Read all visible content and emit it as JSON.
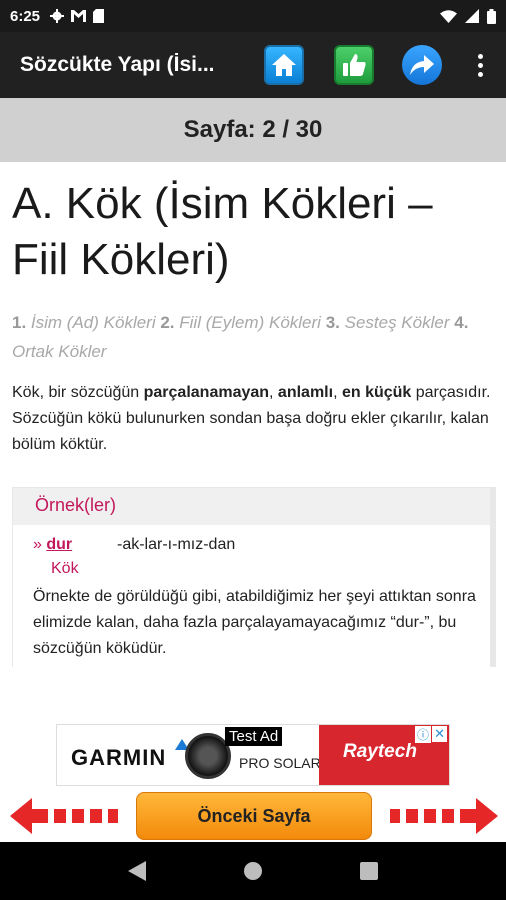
{
  "status_bar": {
    "time": "6:25"
  },
  "app_bar": {
    "title": "Sözcükte Yapı (İsi..."
  },
  "page_indicator": {
    "text": "Sayfa: 2 / 30"
  },
  "content": {
    "heading": "A. Kök (İsim Kökleri – Fiil Kökleri)",
    "toc": [
      {
        "num": "1.",
        "label": "İsim (Ad) Kökleri"
      },
      {
        "num": "2.",
        "label": "Fiil (Eylem) Kökleri"
      },
      {
        "num": "3.",
        "label": "Sesteş Kökler"
      },
      {
        "num": "4.",
        "label": "Ortak Kökler"
      }
    ],
    "intro": {
      "part1": "Kök, bir sözcüğün ",
      "bold1": "parçalanamayan",
      "part2": ", ",
      "bold2": "anlamlı",
      "part3": ", ",
      "bold3": "en küçük",
      "part4": " parçasıdır. Sözcüğün kökü bulunurken sondan başa doğru ekler çıkarılır, kalan bölüm köktür."
    },
    "example": {
      "title": "Örnek(ler)",
      "marker": "»",
      "root": "dur",
      "suffixes": "-ak-lar-ı-mız-dan",
      "root_label": "Kök",
      "text": "Örnekte de görüldüğü gibi, atabildiğimiz her şeyi attıktan sonra elimizde kalan, daha fazla parçalayamayacağımız “dur-”, bu sözcüğün köküdür."
    }
  },
  "ad": {
    "brand_left": "GARMIN",
    "product": "PRO SOLAR",
    "test_label": "Test Ad",
    "brand_right": "Raytech",
    "close": "✕",
    "info": "ⓘ"
  },
  "nav": {
    "prev_label": "Önceki Sayfa"
  },
  "icons": {
    "home": "home-icon",
    "like": "thumbs-up-icon",
    "share": "share-icon",
    "menu": "more-vert-icon"
  },
  "colors": {
    "accent": "#c2185b",
    "app_bar": "#212121",
    "prev_button": "#f7a21e",
    "arrow": "#e52727"
  }
}
